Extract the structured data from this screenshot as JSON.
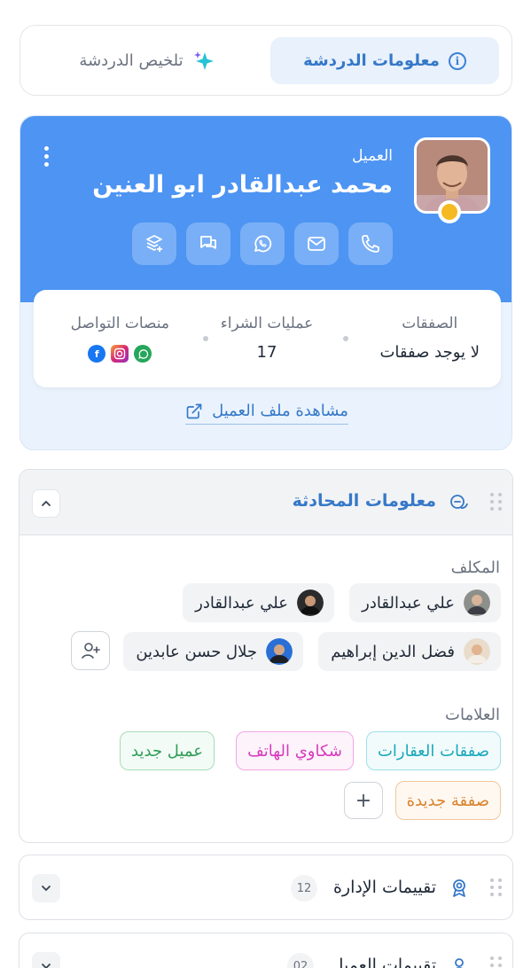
{
  "tabs": {
    "chat_info": "معلومات الدردشة",
    "chat_summary": "تلخيص الدردشة"
  },
  "customer": {
    "label": "العميل",
    "name": "محمد عبدالقادر ابو العنين",
    "actions": [
      "phone-icon",
      "mail-icon",
      "whatsapp-icon",
      "chat-bubbles-icon",
      "layers-add-icon"
    ],
    "stats": {
      "deals_title": "الصفقات",
      "deals_value": "لا يوجد صفقات",
      "purchases_title": "عمليات الشراء",
      "purchases_value": "17",
      "platforms_title": "منصات التواصل",
      "platforms": [
        "whatsapp",
        "instagram",
        "facebook"
      ]
    },
    "view_profile": "مشاهدة ملف العميل"
  },
  "conversation": {
    "title": "معلومات المحادثة",
    "assignee_label": "المكلف",
    "assignees": [
      {
        "name": "علي عبدالقادر"
      },
      {
        "name": "علي عبدالقادر"
      },
      {
        "name": "فضل الدين إبراهيم"
      },
      {
        "name": "جلال حسن عابدين"
      }
    ],
    "tags_label": "العلامات",
    "tags": [
      {
        "label": "صفقات العقارات",
        "color": "#1aa8b8"
      },
      {
        "label": "شكاوي الهاتف",
        "color": "#d63bbd"
      },
      {
        "label": "عميل جديد",
        "color": "#2f9e57"
      },
      {
        "label": "صفقة جديدة",
        "color": "#d9822b"
      }
    ]
  },
  "panels": [
    {
      "title": "تقييمات الإدارة",
      "count": "12"
    },
    {
      "title": "تقييمات العميل",
      "count": "02"
    }
  ],
  "colors": {
    "primary": "#4d94f3",
    "accent_text": "#3578c8"
  }
}
